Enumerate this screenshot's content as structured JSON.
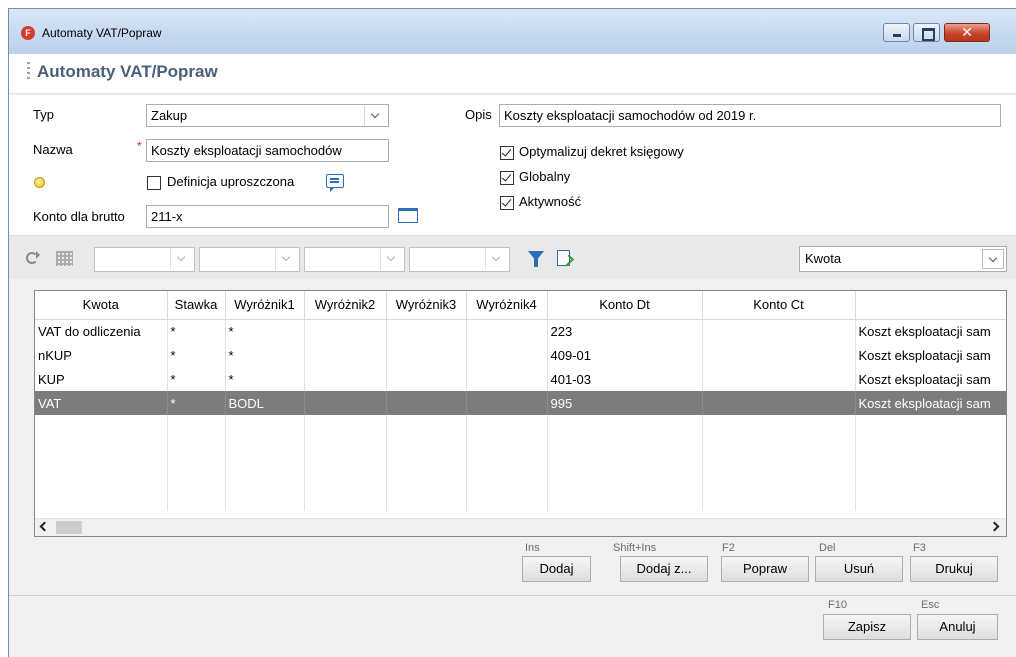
{
  "window": {
    "title": "Automaty VAT/Popraw",
    "app_icon_letter": "F",
    "close_glyph": "✕",
    "icons": [
      "minimize-icon",
      "maximize-icon",
      "close-icon"
    ]
  },
  "page": {
    "title": "Automaty VAT/Popraw"
  },
  "form": {
    "typ_label": "Typ",
    "typ_value": "Zakup",
    "nazwa_label": "Nazwa",
    "nazwa_required": "*",
    "nazwa_value": "Koszty eksploatacji samochodów",
    "definicja_label": "Definicja uproszczona",
    "definicja_checked": false,
    "konto_label": "Konto dla brutto",
    "konto_value": "211-x",
    "opis_label": "Opis",
    "opis_value": "Koszty eksploatacji samochodów od 2019 r.",
    "optymalizuj_label": "Optymalizuj dekret księgowy",
    "optymalizuj_checked": true,
    "globalny_label": "Globalny",
    "globalny_checked": true,
    "aktywnosc_label": "Aktywność",
    "aktywnosc_checked": true
  },
  "toolbar": {
    "filters": [
      "",
      "",
      "",
      ""
    ],
    "column_select_value": "Kwota",
    "icons": [
      "refresh-icon",
      "grid-settings-icon",
      "filter-icon",
      "export-icon"
    ]
  },
  "grid": {
    "columns": [
      "Kwota",
      "Stawka",
      "Wyróżnik1",
      "Wyróżnik2",
      "Wyróżnik3",
      "Wyróżnik4",
      "Konto Dt",
      "Konto Ct",
      ""
    ],
    "rows": [
      [
        "VAT do odliczenia",
        "*",
        "*",
        "",
        "",
        "",
        "223",
        "",
        "Koszt eksploatacji sam"
      ],
      [
        "nKUP",
        "*",
        "*",
        "",
        "",
        "",
        "409-01",
        "",
        "Koszt eksploatacji sam"
      ],
      [
        "KUP",
        "*",
        "*",
        "",
        "",
        "",
        "401-03",
        "",
        "Koszt eksploatacji sam"
      ],
      [
        "VAT",
        "*",
        "BODL",
        "",
        "",
        "",
        "995",
        "",
        "Koszt eksploatacji sam"
      ]
    ],
    "selected_row": 3
  },
  "actions": {
    "dodaj": {
      "shortcut": "Ins",
      "label": "Dodaj"
    },
    "dodaj_z": {
      "shortcut": "Shift+Ins",
      "label": "Dodaj z..."
    },
    "popraw": {
      "shortcut": "F2",
      "label": "Popraw"
    },
    "usun": {
      "shortcut": "Del",
      "label": "Usuń"
    },
    "drukuj": {
      "shortcut": "F3",
      "label": "Drukuj"
    }
  },
  "footer": {
    "zapisz": {
      "shortcut": "F10",
      "label": "Zapisz"
    },
    "anuluj": {
      "shortcut": "Esc",
      "label": "Anuluj"
    }
  }
}
